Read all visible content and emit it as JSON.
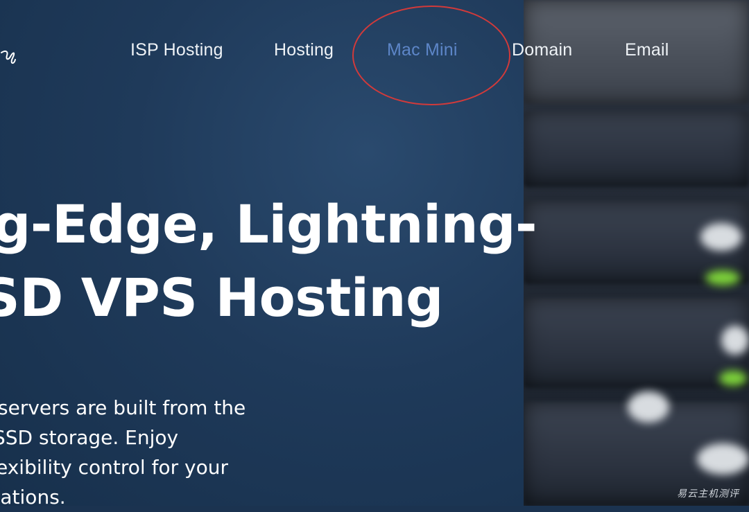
{
  "nav": {
    "items": [
      {
        "label": "ISP Hosting",
        "active": false
      },
      {
        "label": "Hosting",
        "active": false
      },
      {
        "label": "Mac Mini",
        "active": true
      },
      {
        "label": "Domain",
        "active": false
      },
      {
        "label": "Email",
        "active": false
      }
    ]
  },
  "hero": {
    "headline_line1": "g-Edge, Lightning-",
    "headline_line2": "SD VPS Hosting",
    "description_lines": [
      "servers are built from the",
      "SSD storage. Enjoy",
      "exibility control for your",
      "cations."
    ]
  },
  "watermark": "易云主机测评",
  "colors": {
    "panel_bg": "#1f3a5a",
    "nav_text": "#eef2f6",
    "nav_active": "#5d86c8",
    "highlight_circle": "#d23a3a",
    "led_green": "#7dd23a"
  },
  "icons": [
    "logo-fragment-icon",
    "highlight-circle"
  ]
}
